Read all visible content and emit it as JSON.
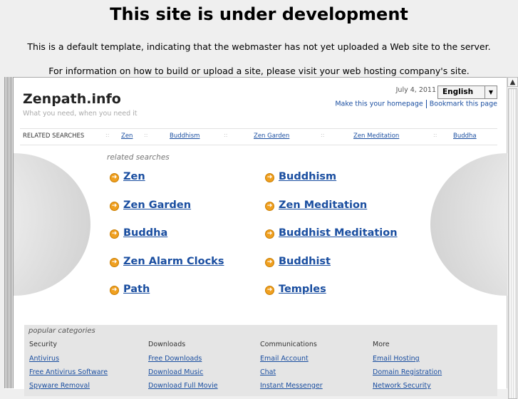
{
  "banner": {
    "title": "This site is under development",
    "line1": "This is a default template, indicating that the webmaster has not yet uploaded a Web site to the server.",
    "line2": "For information on how to build or upload a site, please visit your web hosting company's site."
  },
  "site": {
    "name": "Zenpath.info",
    "tagline": "What you need, when you need it",
    "date": "July 4, 2011",
    "language": "English",
    "make_homepage": "Make this your homepage",
    "bookmark": "Bookmark this page"
  },
  "related_bar": {
    "label": "RELATED SEARCHES",
    "items": [
      "Zen",
      "Buddhism",
      "Zen Garden",
      "Zen Meditation",
      "Buddha"
    ]
  },
  "related": {
    "label": "related searches",
    "left": [
      "Zen",
      "Zen Garden",
      "Buddha",
      "Zen Alarm Clocks",
      "Path"
    ],
    "right": [
      "Buddhism",
      "Zen Meditation",
      "Buddhist Meditation",
      "Buddhist",
      "Temples"
    ]
  },
  "categories": {
    "title": "popular categories",
    "columns": [
      {
        "heading": "Security",
        "links": [
          "Antivirus",
          "Free Antivirus Software",
          "Spyware Removal"
        ]
      },
      {
        "heading": "Downloads",
        "links": [
          "Free Downloads",
          "Download Music",
          "Download Full Movie"
        ]
      },
      {
        "heading": "Communications",
        "links": [
          "Email Account",
          "Chat",
          "Instant Messenger"
        ]
      },
      {
        "heading": "More",
        "links": [
          "Email Hosting",
          "Domain Registration",
          "Network Security"
        ]
      }
    ]
  },
  "icons": {
    "link_bullet": "arrow-circle-icon",
    "scroll_up": "arrow-up-icon",
    "dropdown": "chevron-down-icon"
  },
  "colors": {
    "link": "#1a4ea0",
    "bullet": "#f0a020",
    "background": "#efefef"
  }
}
